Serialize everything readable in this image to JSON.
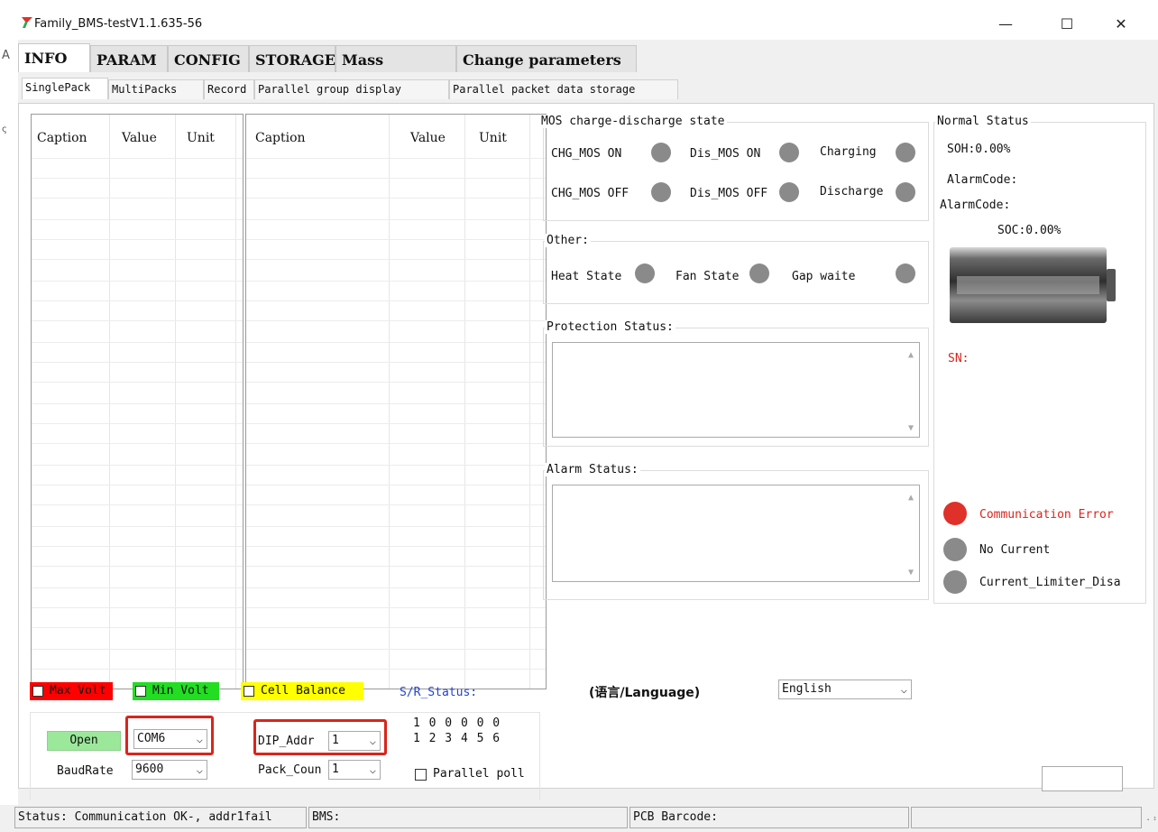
{
  "window": {
    "title": "Family_BMS-testV1.1.635-56",
    "minimize": "—",
    "maximize": "☐",
    "close": "✕"
  },
  "left_edge": {
    "a": "A",
    "b": "ς"
  },
  "main_tabs": [
    "INFO",
    "PARAM",
    "CONFIG",
    "STORAGE",
    "Mass Storage",
    "Change parameters"
  ],
  "sub_tabs": [
    "SinglePack",
    "MultiPacks",
    "Record",
    "Parallel group display",
    "Parallel packet data storage"
  ],
  "table": {
    "caption": "Caption",
    "value": "Value",
    "unit": "Unit"
  },
  "mos": {
    "title": "MOS charge-discharge state",
    "chg_on": "CHG_MOS ON",
    "dis_on": "Dis_MOS ON",
    "charging": "Charging",
    "chg_off": "CHG_MOS OFF",
    "dis_off": "Dis_MOS OFF",
    "discharge": "Discharge"
  },
  "other": {
    "title": "Other:",
    "heat": "Heat State",
    "fan": "Fan State",
    "gap": "Gap waite"
  },
  "protection": {
    "title": "Protection Status:"
  },
  "alarm": {
    "title": "Alarm Status:"
  },
  "normal": {
    "title": "Normal Status",
    "soh": "SOH:0.00%",
    "alarm1": "AlarmCode:",
    "alarm2": "AlarmCode:",
    "soc": "SOC:0.00%",
    "sn": "SN:",
    "comm_error": "Communication Error",
    "no_current": "No Current",
    "current_limiter": "Current_Limiter_Disa"
  },
  "legend": {
    "max_volt": "Max Volt",
    "min_volt": "Min Volt",
    "cell_balance": "Cell Balance",
    "sr_status": "S/R_Status:"
  },
  "language": {
    "label": "(语言/Language)",
    "value": "English"
  },
  "connection": {
    "open": "Open",
    "com": "COM6",
    "baud_label": "BaudRate",
    "baud": "9600",
    "dip_label": "DIP_Addr",
    "dip": "1",
    "pack_label": "Pack_Coun",
    "pack": "1",
    "dip_row1": "1 0 0 0 0 0",
    "dip_row2": "1 2 3 4 5 6",
    "parallel": "Parallel poll"
  },
  "statusbar": {
    "status": "Status: Communication OK-, addr1fail",
    "bms": "BMS:",
    "pcb": "PCB Barcode:"
  },
  "colors": {
    "max_volt": "#ff0000",
    "min_volt": "#22dd22",
    "cell_balance": "#ffff00",
    "open_button": "#9be89b",
    "led_off": "#8a8a8a",
    "led_error": "#e0302a",
    "sn": "#d9251c",
    "sr_status": "#2244cc",
    "highlight": "#d9251c"
  }
}
